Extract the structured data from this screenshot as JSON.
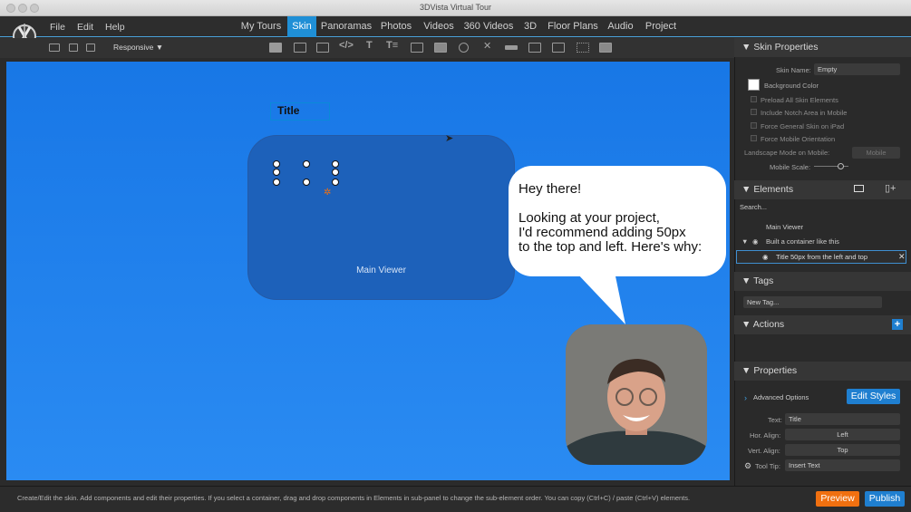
{
  "window": {
    "title": "3DVista Virtual Tour"
  },
  "menu": {
    "file": "File",
    "edit": "Edit",
    "help": "Help"
  },
  "tabs": [
    {
      "label": "My Tours"
    },
    {
      "label": "Skin"
    },
    {
      "label": "Panoramas"
    },
    {
      "label": "Photos"
    },
    {
      "label": "Videos"
    },
    {
      "label": "360 Videos"
    },
    {
      "label": "3D"
    },
    {
      "label": "Floor Plans"
    },
    {
      "label": "Audio"
    },
    {
      "label": "Project"
    }
  ],
  "active_tab": "Skin",
  "toolbar": {
    "responsive_label": "Responsive ▼"
  },
  "canvas": {
    "title_text": "Title",
    "main_viewer_label": "Main Viewer",
    "speech": [
      "Hey there!",
      "",
      "Looking at your project,",
      "I'd recommend adding 50px",
      "to the top and left. Here's why:"
    ]
  },
  "skin_properties": {
    "header": "Skin Properties",
    "skin_name_label": "Skin Name:",
    "skin_name_value": "Empty",
    "background_color_label": "Background Color",
    "preload_label": "Preload All Skin Elements",
    "notch_label": "Include Notch Area in Mobile",
    "force_general_label": "Force General Skin on iPad",
    "force_orientation_label": "Force Mobile Orientation",
    "landscape_label": "Landscape Mode on Mobile:",
    "landscape_value": "Mobile",
    "mobile_scale_label": "Mobile Scale:",
    "mobile_scale_value": 0.75
  },
  "elements": {
    "header": "Elements",
    "search_placeholder": "Search...",
    "tree": [
      {
        "label": "Main Viewer"
      },
      {
        "label": "Built a container like this"
      },
      {
        "label": "Title 50px from the left and top"
      }
    ]
  },
  "tags": {
    "header": "Tags",
    "new_tag": "New Tag..."
  },
  "actions": {
    "header": "Actions"
  },
  "properties": {
    "header": "Properties",
    "advanced_options": "Advanced Options",
    "edit_styles": "Edit Styles",
    "text_label": "Text:",
    "text_value": "Title",
    "hor_align_label": "Hor. Align:",
    "hor_align_value": "Left",
    "vert_align_label": "Vert. Align:",
    "vert_align_value": "Top",
    "tooltip_label": "Tool Tip:",
    "tooltip_value": "Insert Text"
  },
  "status": {
    "text": "Create/Edit the skin. Add components and edit their properties. If you select a container, drag and drop components in Elements in sub-panel to change the sub-element order. You can copy (Ctrl+C) / paste (Ctrl+V) elements.",
    "preview": "Preview",
    "publish": "Publish"
  },
  "colors": {
    "accent": "#1f8fd6",
    "preview": "#f07010",
    "publish": "#1f7fd0",
    "canvas": "#1877e6"
  },
  "icons": [
    "layout-icon",
    "save-icon",
    "share-icon",
    "rectangle-icon",
    "container-icon",
    "frame-icon",
    "code-icon",
    "text-icon",
    "text-list-icon",
    "image-icon",
    "image-button-icon",
    "video-icon",
    "close-icon",
    "slider-icon",
    "table-icon",
    "grid-icon",
    "more-icon",
    "eye-icon",
    "monitor-icon",
    "mobile-add-icon",
    "gear-icon",
    "plus-icon"
  ]
}
